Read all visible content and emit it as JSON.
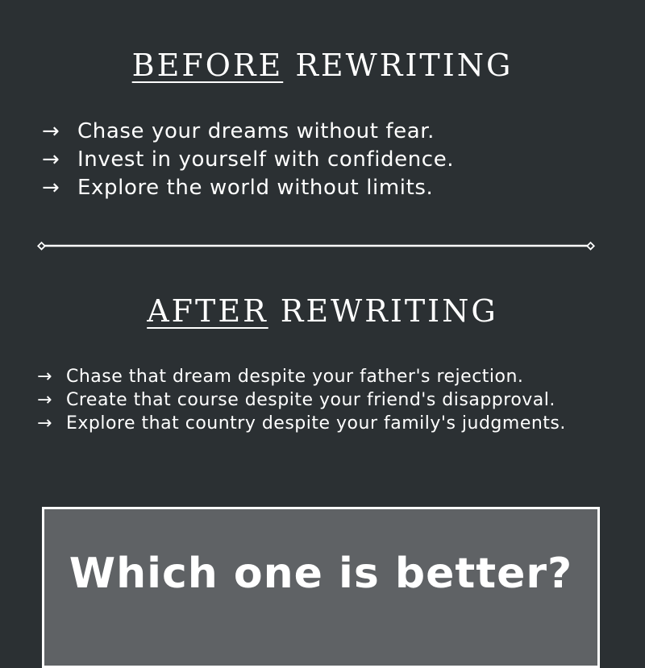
{
  "before_section": {
    "heading_underlined": "BEFORE",
    "heading_rest": "REWRITING",
    "items": [
      "Chase your dreams without fear.",
      "Invest in yourself with confidence.",
      "Explore the world without limits."
    ]
  },
  "after_section": {
    "heading_underlined": "AFTER",
    "heading_rest": "REWRITING",
    "items": [
      "Chase that dream despite your father's rejection.",
      "Create that course despite your friend's disapproval.",
      "Explore that country despite your family's judgments."
    ]
  },
  "bullet_arrow": "→",
  "question": "Which one is better?",
  "colors": {
    "background": "#2b3033",
    "text": "#ffffff",
    "box": "#5f6265"
  }
}
